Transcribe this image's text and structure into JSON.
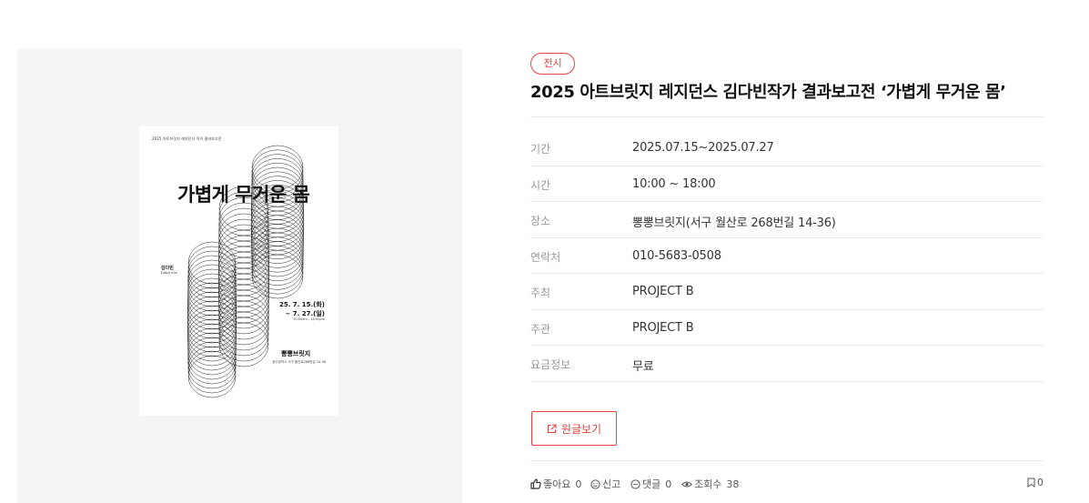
{
  "poster": {
    "subtitle": "2025 아트브릿지 레지던시 작가 결과보고전",
    "title": "가볍게 무거운 몸",
    "artist_kr": "김다빈",
    "artist_en": "Dabin Kim",
    "date_line1": "25. 7. 15.(화)",
    "date_line2": "~ 7. 27.(일)",
    "time": "10:00am - 18:00pm",
    "venue": "뽕뽕브릿지",
    "address": "광주광역시 서구 월산로268번길 14-36"
  },
  "event": {
    "category": "전시",
    "title": "2025 아트브릿지 레지던스 김다빈작가 결과보고전 ‘가볍게 무거운 몸’",
    "details": [
      {
        "label": "기간",
        "value": "2025.07.15~2025.07.27"
      },
      {
        "label": "시간",
        "value": "10:00 ~ 18:00"
      },
      {
        "label": "장소",
        "value": "뽕뽕브릿지(서구 월산로 268번길 14-36)"
      },
      {
        "label": "연락처",
        "value": "010-5683-0508"
      },
      {
        "label": "주최",
        "value": "PROJECT B"
      },
      {
        "label": "주관",
        "value": "PROJECT B"
      },
      {
        "label": "요금정보",
        "value": "무료"
      }
    ],
    "source_button_label": "원글보기"
  },
  "actions": {
    "like_label": "좋아요",
    "like_count": "0",
    "report_label": "신고",
    "comment_label": "댓글",
    "comment_count": "0",
    "views_label": "조회수",
    "views_count": "38",
    "bookmark_count": "0"
  },
  "icons": {
    "like": "thumbs-up-icon",
    "report": "smile-icon",
    "comment": "chat-bubble-icon",
    "views": "eye-icon",
    "bookmark": "bookmark-icon",
    "external": "external-link-icon"
  },
  "colors": {
    "accent": "#e8413e",
    "panel_bg": "#f5f5f5",
    "label": "#999999",
    "text": "#333333"
  }
}
